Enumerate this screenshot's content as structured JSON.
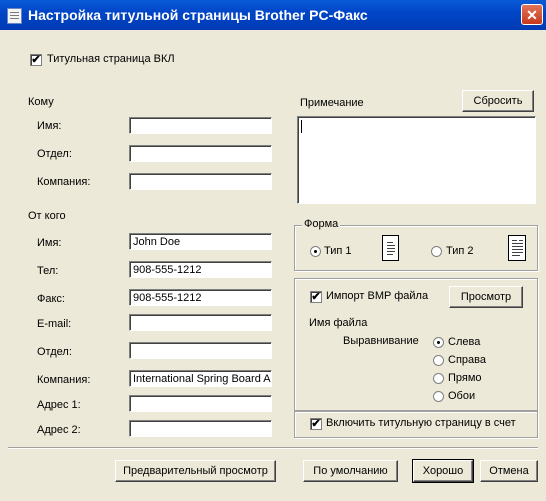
{
  "window": {
    "title": "Настройка титульной страницы Brother PC-Факс",
    "close": "✕"
  },
  "cover_on": {
    "label": "Титульная страница ВКЛ",
    "checked": true
  },
  "to": {
    "heading": "Кому",
    "name_label": "Имя:",
    "name_value": "",
    "dept_label": "Отдел:",
    "dept_value": "",
    "company_label": "Компания:",
    "company_value": ""
  },
  "from": {
    "heading": "От кого",
    "name_label": "Имя:",
    "name_value": "John Doe",
    "tel_label": "Тел:",
    "tel_value": "908-555-1212",
    "fax_label": "Факс:",
    "fax_value": "908-555-1212",
    "email_label": "E-mail:",
    "email_value": "",
    "dept_label": "Отдел:",
    "dept_value": "",
    "company_label": "Компания:",
    "company_value": "International Spring Board Assoc",
    "addr1_label": "Адрес 1:",
    "addr1_value": "",
    "addr2_label": "Адрес 2:",
    "addr2_value": ""
  },
  "note": {
    "label": "Примечание",
    "reset_button": "Сбросить",
    "value": ""
  },
  "form": {
    "legend": "Форма",
    "type1_label": "Тип 1",
    "type1_selected": true,
    "type2_label": "Тип 2",
    "type2_selected": false
  },
  "bmp": {
    "import_label": "Импорт BMP файла",
    "import_checked": true,
    "preview_button": "Просмотр",
    "filename_label": "Имя файла",
    "align_label": "Выравнивание",
    "align_options": [
      "Слева",
      "Справа",
      "Прямо",
      "Обои"
    ],
    "align_selected": "Слева"
  },
  "include_count": {
    "label": "Включить титульную страницу в счет",
    "checked": true
  },
  "buttons": {
    "preview": "Предварительный просмотр",
    "defaults": "По умолчанию",
    "ok": "Хорошо",
    "cancel": "Отмена"
  }
}
